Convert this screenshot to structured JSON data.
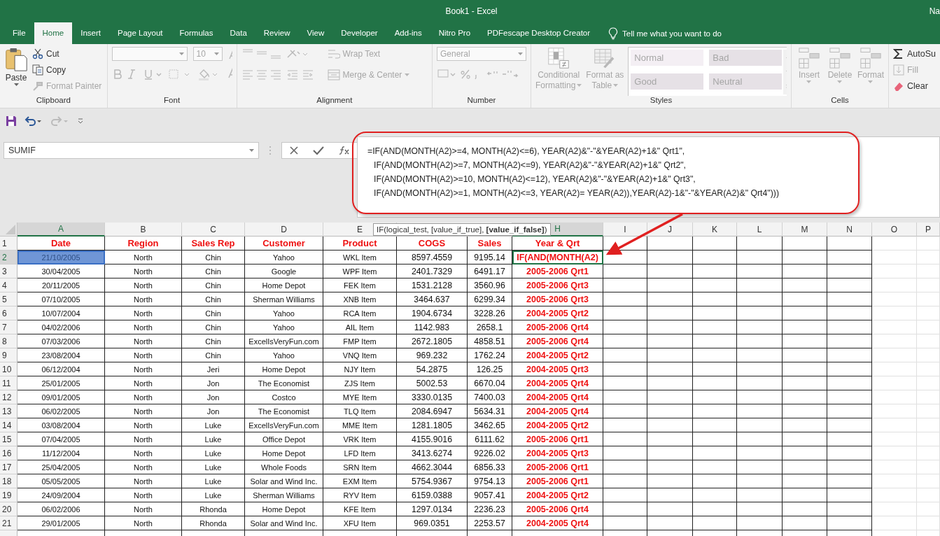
{
  "window": {
    "title": "Book1  -  Excel",
    "user": "Na"
  },
  "tabs": [
    {
      "label": "File",
      "selected": false
    },
    {
      "label": "Home",
      "selected": true
    },
    {
      "label": "Insert",
      "selected": false
    },
    {
      "label": "Page Layout",
      "selected": false
    },
    {
      "label": "Formulas",
      "selected": false
    },
    {
      "label": "Data",
      "selected": false
    },
    {
      "label": "Review",
      "selected": false
    },
    {
      "label": "View",
      "selected": false
    },
    {
      "label": "Developer",
      "selected": false
    },
    {
      "label": "Add-ins",
      "selected": false
    },
    {
      "label": "Nitro Pro",
      "selected": false
    },
    {
      "label": "PDFescape Desktop Creator",
      "selected": false
    }
  ],
  "tell_me": "Tell me what you want to do",
  "ribbon": {
    "groups": [
      {
        "kind": "clipboard",
        "label": "Clipboard",
        "disabled": false,
        "paste": "Paste",
        "items": [
          {
            "label": "Cut",
            "disabled": false
          },
          {
            "label": "Copy",
            "disabled": false
          },
          {
            "label": "Format Painter",
            "disabled": true
          }
        ]
      },
      {
        "kind": "font",
        "label": "Font",
        "disabled": true,
        "font_size": "10"
      },
      {
        "kind": "alignment",
        "label": "Alignment",
        "disabled": true,
        "wrap": "Wrap Text",
        "merge": "Merge & Center"
      },
      {
        "kind": "number",
        "label": "Number",
        "disabled": true,
        "format": "General"
      },
      {
        "kind": "styles",
        "label": "Styles",
        "disabled": true,
        "conditional": [
          "Conditional",
          "Formatting"
        ],
        "table": [
          "Format as",
          "Table"
        ],
        "gallery": [
          {
            "label": "Normal",
            "selected": true
          },
          {
            "label": "Bad",
            "selected": false
          },
          {
            "label": "Good",
            "selected": false
          },
          {
            "label": "Neutral",
            "selected": false
          }
        ]
      },
      {
        "kind": "cells",
        "label": "Cells",
        "disabled": true,
        "buttons": [
          "Insert",
          "Delete",
          "Format"
        ]
      },
      {
        "kind": "editing",
        "items": [
          {
            "label": "AutoSu",
            "disabled": false
          },
          {
            "label": "Fill",
            "disabled": true
          },
          {
            "label": "Clear",
            "disabled": false
          }
        ]
      }
    ]
  },
  "name_box": "SUMIF",
  "formula_lines": [
    "=IF(AND(MONTH(A2)>=4, MONTH(A2)<=6), YEAR(A2)&\"-\"&YEAR(A2)+1&\" Qrt1\",",
    "IF(AND(MONTH(A2)>=7, MONTH(A2)<=9), YEAR(A2)&\"-\"&YEAR(A2)+1&\" Qrt2\",",
    "IF(AND(MONTH(A2)>=10, MONTH(A2)<=12), YEAR(A2)&\"-\"&YEAR(A2)+1&\" Qrt3\",",
    "IF(AND(MONTH(A2)>=1, MONTH(A2)<=3, YEAR(A2)= YEAR(A2)),YEAR(A2)-1&\"-\"&YEAR(A2)&\" Qrt4\")))"
  ],
  "tooltip": "IF(logical_test, [value_if_true], **[value_if_false]**)",
  "column_headers": [
    {
      "letter": "A",
      "selected": true
    },
    {
      "letter": "B",
      "selected": false
    },
    {
      "letter": "C",
      "selected": false
    },
    {
      "letter": "D",
      "selected": false
    },
    {
      "letter": "E",
      "selected": false
    },
    {
      "letter": "H",
      "selected": true
    },
    {
      "letter": "I",
      "selected": false
    },
    {
      "letter": "J",
      "selected": false
    },
    {
      "letter": "K",
      "selected": false
    },
    {
      "letter": "L",
      "selected": false
    },
    {
      "letter": "M",
      "selected": false
    },
    {
      "letter": "N",
      "selected": false
    },
    {
      "letter": "O",
      "selected": false
    },
    {
      "letter": "P",
      "selected": false
    }
  ],
  "header_row": {
    "number": "1",
    "cells": [
      "Date",
      "Region",
      "Sales Rep",
      "Customer",
      "Product",
      "COGS",
      "Sales",
      "Year & Qrt"
    ]
  },
  "rows": [
    {
      "number": "2",
      "selected": true,
      "editing": true,
      "cells": [
        "21/10/2005",
        "North",
        "Chin",
        "Yahoo",
        "WKL Item",
        "8597.4559",
        "9195.14",
        "IF(AND(MONTH(A2)"
      ]
    },
    {
      "number": "3",
      "selected": false,
      "editing": false,
      "cells": [
        "30/04/2005",
        "North",
        "Chin",
        "Google",
        "WPF Item",
        "2401.7329",
        "6491.17",
        "2005-2006 Qrt1"
      ]
    },
    {
      "number": "4",
      "selected": false,
      "editing": false,
      "cells": [
        "20/11/2005",
        "North",
        "Chin",
        "Home Depot",
        "FEK Item",
        "1531.2128",
        "3560.96",
        "2005-2006 Qrt3"
      ]
    },
    {
      "number": "5",
      "selected": false,
      "editing": false,
      "cells": [
        "07/10/2005",
        "North",
        "Chin",
        "Sherman Williams",
        "XNB Item",
        "3464.637",
        "6299.34",
        "2005-2006 Qrt3"
      ]
    },
    {
      "number": "6",
      "selected": false,
      "editing": false,
      "cells": [
        "10/07/2004",
        "North",
        "Chin",
        "Yahoo",
        "RCA Item",
        "1904.6734",
        "3228.26",
        "2004-2005 Qrt2"
      ]
    },
    {
      "number": "7",
      "selected": false,
      "editing": false,
      "cells": [
        "04/02/2006",
        "North",
        "Chin",
        "Yahoo",
        "AIL Item",
        "1142.983",
        "2658.1",
        "2005-2006 Qrt4"
      ]
    },
    {
      "number": "8",
      "selected": false,
      "editing": false,
      "cells": [
        "07/03/2006",
        "North",
        "Chin",
        "ExcelIsVeryFun.com",
        "FMP Item",
        "2672.1805",
        "4858.51",
        "2005-2006 Qrt4"
      ]
    },
    {
      "number": "9",
      "selected": false,
      "editing": false,
      "cells": [
        "23/08/2004",
        "North",
        "Chin",
        "Yahoo",
        "VNQ Item",
        "969.232",
        "1762.24",
        "2004-2005 Qrt2"
      ]
    },
    {
      "number": "10",
      "selected": false,
      "editing": false,
      "cells": [
        "06/12/2004",
        "North",
        "Jeri",
        "Home Depot",
        "NJY Item",
        "54.2875",
        "126.25",
        "2004-2005 Qrt3"
      ]
    },
    {
      "number": "11",
      "selected": false,
      "editing": false,
      "cells": [
        "25/01/2005",
        "North",
        "Jon",
        "The Economist",
        "ZJS Item",
        "5002.53",
        "6670.04",
        "2004-2005 Qrt4"
      ]
    },
    {
      "number": "12",
      "selected": false,
      "editing": false,
      "cells": [
        "09/01/2005",
        "North",
        "Jon",
        "Costco",
        "MYE Item",
        "3330.0135",
        "7400.03",
        "2004-2005 Qrt4"
      ]
    },
    {
      "number": "13",
      "selected": false,
      "editing": false,
      "cells": [
        "06/02/2005",
        "North",
        "Jon",
        "The Economist",
        "TLQ Item",
        "2084.6947",
        "5634.31",
        "2004-2005 Qrt4"
      ]
    },
    {
      "number": "14",
      "selected": false,
      "editing": false,
      "cells": [
        "03/08/2004",
        "North",
        "Luke",
        "ExcelIsVeryFun.com",
        "MME Item",
        "1281.1805",
        "3462.65",
        "2004-2005 Qrt2"
      ]
    },
    {
      "number": "15",
      "selected": false,
      "editing": false,
      "cells": [
        "07/04/2005",
        "North",
        "Luke",
        "Office Depot",
        "VRK Item",
        "4155.9016",
        "6111.62",
        "2005-2006 Qrt1"
      ]
    },
    {
      "number": "16",
      "selected": false,
      "editing": false,
      "cells": [
        "11/12/2004",
        "North",
        "Luke",
        "Home Depot",
        "LFD Item",
        "3413.6274",
        "9226.02",
        "2004-2005 Qrt3"
      ]
    },
    {
      "number": "17",
      "selected": false,
      "editing": false,
      "cells": [
        "25/04/2005",
        "North",
        "Luke",
        "Whole Foods",
        "SRN Item",
        "4662.3044",
        "6856.33",
        "2005-2006 Qrt1"
      ]
    },
    {
      "number": "18",
      "selected": false,
      "editing": false,
      "cells": [
        "05/05/2005",
        "North",
        "Luke",
        "Solar and Wind Inc.",
        "EXM Item",
        "5754.9367",
        "9754.13",
        "2005-2006 Qrt1"
      ]
    },
    {
      "number": "19",
      "selected": false,
      "editing": false,
      "cells": [
        "24/09/2004",
        "North",
        "Luke",
        "Sherman Williams",
        "RYV Item",
        "6159.0388",
        "9057.41",
        "2004-2005 Qrt2"
      ]
    },
    {
      "number": "20",
      "selected": false,
      "editing": false,
      "cells": [
        "06/02/2006",
        "North",
        "Rhonda",
        "Home Depot",
        "KFE Item",
        "1297.0134",
        "2236.23",
        "2005-2006 Qrt4"
      ]
    },
    {
      "number": "21",
      "selected": false,
      "editing": false,
      "cells": [
        "29/01/2005",
        "North",
        "Rhonda",
        "Solar and Wind Inc.",
        "XFU Item",
        "969.0351",
        "2253.57",
        "2004-2005 Qrt4"
      ]
    }
  ]
}
